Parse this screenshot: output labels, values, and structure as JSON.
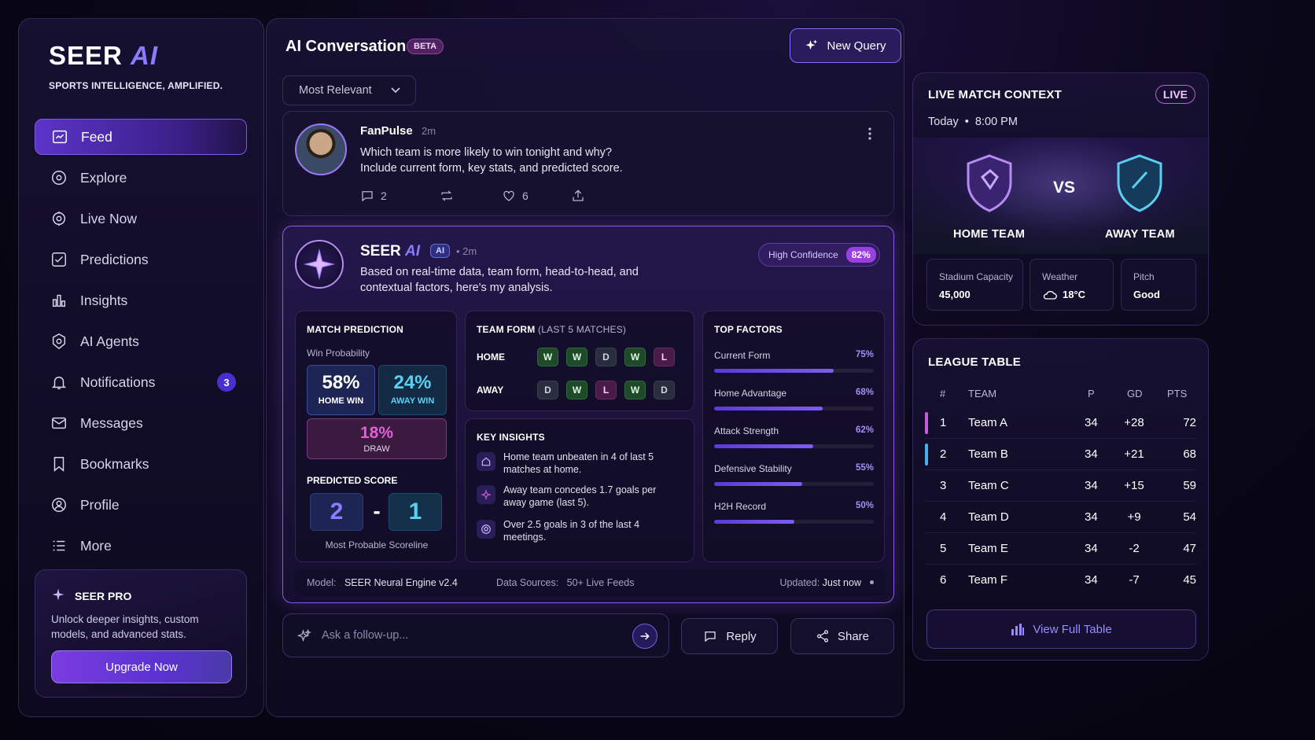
{
  "sidebar": {
    "logo_main": "SEER",
    "logo_ai": "AI",
    "tagline": "SPORTS INTELLIGENCE, AMPLIFIED.",
    "items": [
      {
        "label": "Feed",
        "icon": "feed-icon",
        "active": true
      },
      {
        "label": "Explore",
        "icon": "explore-icon"
      },
      {
        "label": "Live Now",
        "icon": "live-icon"
      },
      {
        "label": "Predictions",
        "icon": "predictions-icon"
      },
      {
        "label": "Insights",
        "icon": "insights-icon"
      },
      {
        "label": "AI Agents",
        "icon": "agents-icon"
      },
      {
        "label": "Notifications",
        "icon": "bell-icon",
        "badge": "3"
      },
      {
        "label": "Messages",
        "icon": "mail-icon"
      },
      {
        "label": "Bookmarks",
        "icon": "bookmark-icon"
      },
      {
        "label": "Profile",
        "icon": "profile-icon"
      },
      {
        "label": "More",
        "icon": "more-icon"
      }
    ],
    "pro": {
      "title": "SEER PRO",
      "text": "Unlock deeper insights, custom models, and advanced stats.",
      "button": "Upgrade Now"
    }
  },
  "main": {
    "title": "AI Conversation",
    "beta": "BETA",
    "new_query": "New Query",
    "sort": "Most Relevant",
    "post": {
      "author": "FanPulse",
      "time": "2m",
      "line1": "Which team is more likely to win tonight and why?",
      "line2": "Include current form, key stats, and predicted score.",
      "comments": "2",
      "likes": "6"
    },
    "ai": {
      "name_main": "SEER",
      "name_ai": "AI",
      "tag": "AI",
      "time": "• 2m",
      "text": "Based on real-time data, team form, head-to-head, and contextual factors, here's my analysis.",
      "confidence_label": "High Confidence",
      "confidence_value": "82%",
      "prediction": {
        "title": "MATCH PREDICTION",
        "subtitle": "Win Probability",
        "home_pct": "58%",
        "home_label": "HOME WIN",
        "away_pct": "24%",
        "away_label": "AWAY WIN",
        "draw_pct": "18%",
        "draw_label": "DRAW",
        "score_title": "PREDICTED SCORE",
        "home_score": "2",
        "dash": "-",
        "away_score": "1",
        "score_caption": "Most Probable Scoreline"
      },
      "form": {
        "title": "TEAM FORM",
        "subtitle": "(LAST 5 MATCHES)",
        "home_label": "HOME",
        "home": [
          "W",
          "W",
          "D",
          "W",
          "L"
        ],
        "away_label": "AWAY",
        "away": [
          "D",
          "W",
          "L",
          "W",
          "D"
        ]
      },
      "insights": {
        "title": "KEY INSIGHTS",
        "items": [
          "Home team unbeaten in 4 of last 5 matches at home.",
          "Away team concedes 1.7 goals per away game (last 5).",
          "Over 2.5 goals in 3 of the last 4 meetings."
        ]
      },
      "factors": {
        "title": "TOP FACTORS",
        "items": [
          {
            "label": "Current Form",
            "value": "75%",
            "pct": 75
          },
          {
            "label": "Home Advantage",
            "value": "68%",
            "pct": 68
          },
          {
            "label": "Attack Strength",
            "value": "62%",
            "pct": 62
          },
          {
            "label": "Defensive Stability",
            "value": "55%",
            "pct": 55
          },
          {
            "label": "H2H Record",
            "value": "50%",
            "pct": 50
          }
        ]
      },
      "footer": {
        "model_label": "Model:",
        "model": "SEER Neural Engine v2.4",
        "sources_label": "Data Sources:",
        "sources": "50+ Live Feeds",
        "updated_label": "Updated:",
        "updated": "Just now"
      }
    },
    "ask_placeholder": "Ask a follow-up...",
    "reply": "Reply",
    "share": "Share"
  },
  "live": {
    "title": "LIVE MATCH CONTEXT",
    "badge": "LIVE",
    "day": "Today",
    "sep": "•",
    "time": "8:00 PM",
    "vs": "VS",
    "home": "HOME TEAM",
    "away": "AWAY TEAM",
    "stats": [
      {
        "label": "Stadium Capacity",
        "value": "45,000"
      },
      {
        "label": "Weather",
        "value": "18°C",
        "icon": "cloud-icon"
      },
      {
        "label": "Pitch",
        "value": "Good"
      }
    ]
  },
  "league": {
    "title": "LEAGUE TABLE",
    "headers": [
      "#",
      "TEAM",
      "P",
      "GD",
      "PTS"
    ],
    "rows": [
      [
        "1",
        "Team A",
        "34",
        "+28",
        "72"
      ],
      [
        "2",
        "Team B",
        "34",
        "+21",
        "68"
      ],
      [
        "3",
        "Team C",
        "34",
        "+15",
        "59"
      ],
      [
        "4",
        "Team D",
        "34",
        "+9",
        "54"
      ],
      [
        "5",
        "Team E",
        "34",
        "-2",
        "47"
      ],
      [
        "6",
        "Team F",
        "34",
        "-7",
        "45"
      ]
    ],
    "view_full": "View Full Table"
  },
  "colors": {
    "accent": "#8b7bff",
    "live": "#c45ce0",
    "win": "#2e6b3b",
    "loss": "#6b2a66"
  }
}
